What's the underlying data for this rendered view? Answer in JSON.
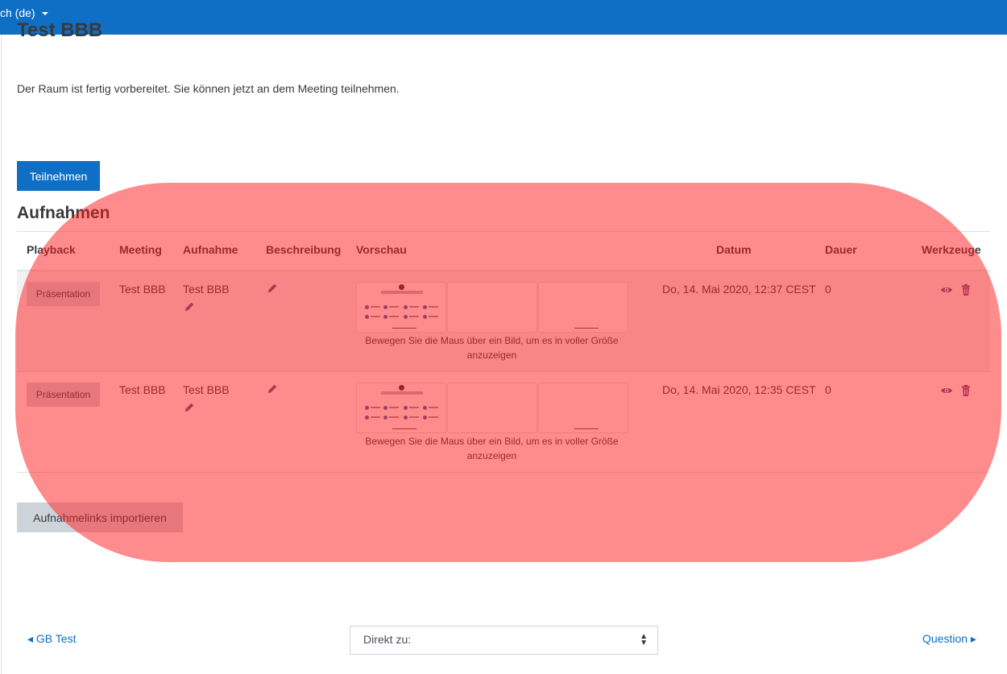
{
  "topbar": {
    "language": "ch (de)"
  },
  "page": {
    "title": "Test BBB",
    "intro": "Der Raum ist fertig vorbereitet. Sie können jetzt an dem Meeting teilnehmen.",
    "join_button": "Teilnehmen",
    "recordings_heading": "Aufnahmen",
    "import_button": "Aufnahmelinks importieren"
  },
  "table": {
    "headers": [
      "Playback",
      "Meeting",
      "Aufnahme",
      "Beschreibung",
      "Vorschau",
      "Datum",
      "Dauer",
      "Werkzeuge"
    ],
    "rows": [
      {
        "playback": "Präsentation",
        "meeting": "Test BBB",
        "recording": "Test BBB",
        "date": "Do, 14. Mai 2020, 12:37 CEST",
        "duration": "0",
        "preview_hint": "Bewegen Sie die Maus über ein Bild, um es in voller Größe anzuzeigen"
      },
      {
        "playback": "Präsentation",
        "meeting": "Test BBB",
        "recording": "Test BBB",
        "date": "Do, 14. Mai 2020, 12:35 CEST",
        "duration": "0",
        "preview_hint": "Bewegen Sie die Maus über ein Bild, um es in voller Größe anzuzeigen"
      }
    ]
  },
  "footer": {
    "prev_link": "◂ GB Test",
    "jump_label": "Direkt zu:",
    "next_link": "Question ▸"
  },
  "colors": {
    "brand": "#0f6fc5",
    "overlay": "#ff1919"
  },
  "icons": [
    "pencil-icon",
    "eye-icon",
    "trash-icon",
    "caret-down-icon",
    "select-caret-icon"
  ]
}
